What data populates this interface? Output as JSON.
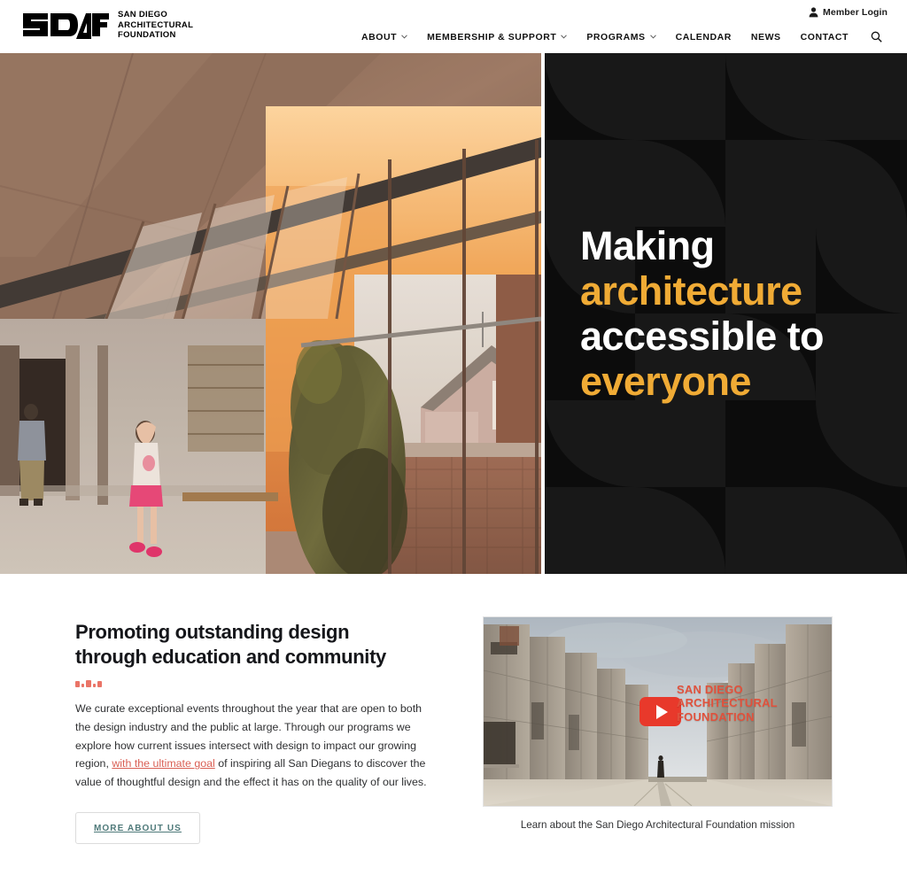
{
  "header": {
    "logo": {
      "mark_text": "SDAF",
      "icon": "sdaf-logo-icon",
      "line1": "San Diego",
      "line2": "Architectural",
      "line3": "Foundation"
    },
    "member_login": {
      "label": "Member Login",
      "icon": "person-icon"
    },
    "nav": [
      {
        "label": "ABOUT",
        "has_dropdown": true
      },
      {
        "label": "MEMBERSHIP & SUPPORT",
        "has_dropdown": true
      },
      {
        "label": "PROGRAMS",
        "has_dropdown": true
      },
      {
        "label": "CALENDAR",
        "has_dropdown": false
      },
      {
        "label": "NEWS",
        "has_dropdown": false
      },
      {
        "label": "CONTACT",
        "has_dropdown": false
      }
    ],
    "search": {
      "icon": "search-icon",
      "label": "Search"
    }
  },
  "hero": {
    "photo_alt": "Person walking through a concrete and glass architectural corridor at sunset",
    "heading": {
      "line1": "Making",
      "line2": "architecture",
      "line3": "accessible to",
      "line4": "everyone"
    },
    "colors": {
      "gold": "#f0ab35",
      "white": "#ffffff",
      "panel_bg": "#0c0c0c"
    }
  },
  "main": {
    "title_line1": "Promoting outstanding design",
    "title_line2": "through education and community",
    "body_part1": "We curate exceptional events throughout the year that are open to both the design industry and the public at large. Through our programs we explore how current issues intersect with design to impact our growing region, ",
    "body_link": "with the ultimate goal",
    "body_part2": " of inspiring all San Diegans to discover the value of thoughtful design and the effect it has on the quality of our lives.",
    "cta_label": "More About Us",
    "video": {
      "brand_line1": "San Diego",
      "brand_line2": "Architectural",
      "brand_line3": "Foundation",
      "play_icon": "youtube-play-icon",
      "caption": "Learn about the San Diego Architectural Foundation mission",
      "thumbnail_alt": "Salk Institute courtyard with lone figure"
    },
    "colors": {
      "accent_red": "#e8685a",
      "link_red": "#d95f54",
      "button_text": "#4f7a7a",
      "youtube_red": "#e8392b"
    }
  }
}
